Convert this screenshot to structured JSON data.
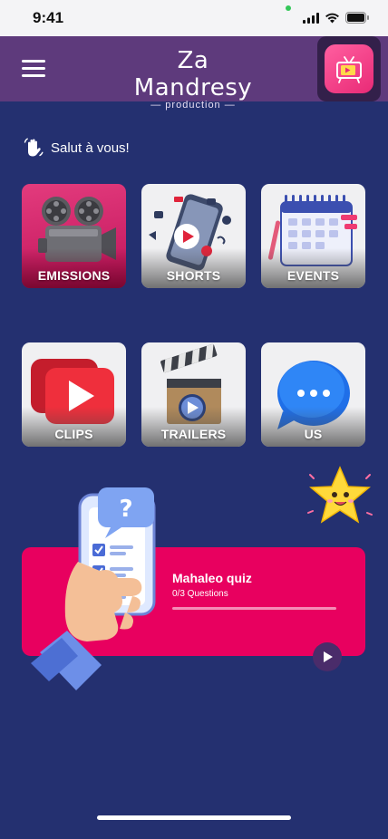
{
  "status_bar": {
    "time": "9:41"
  },
  "header": {
    "logo_main": "Za Mandresy",
    "logo_sub": "— production —"
  },
  "greeting": {
    "text": "Salut à vous!"
  },
  "tiles": [
    {
      "label": "EMISSIONS",
      "icon": "film-projector-icon"
    },
    {
      "label": "SHORTS",
      "icon": "phone-play-icon"
    },
    {
      "label": "EVENTS",
      "icon": "calendar-icon"
    },
    {
      "label": "CLIPS",
      "icon": "play-button-icon"
    },
    {
      "label": "TRAILERS",
      "icon": "clapperboard-icon"
    },
    {
      "label": "US",
      "icon": "chat-bubble-icon"
    }
  ],
  "quiz": {
    "title": "Mahaleo quiz",
    "progress_text": "0/3 Questions",
    "progress": 0
  },
  "colors": {
    "background": "#243070",
    "header": "#5e3a7c",
    "accent": "#e8005f"
  }
}
